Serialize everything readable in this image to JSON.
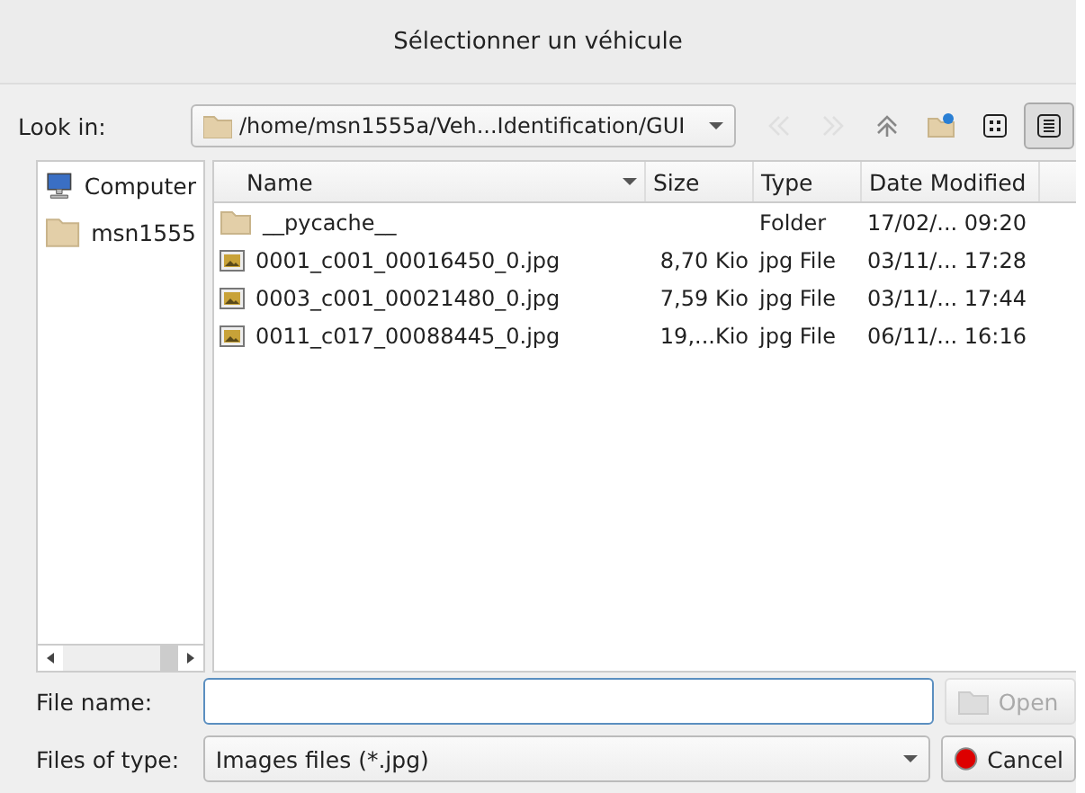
{
  "window": {
    "title": "Sélectionner un véhicule"
  },
  "look_in": {
    "label": "Look in:",
    "path": "/home/msn1555a/Veh...Identification/GUI"
  },
  "toolbar": [
    {
      "kind": "back",
      "disabled": true
    },
    {
      "kind": "forward",
      "disabled": true
    },
    {
      "kind": "up",
      "disabled": false
    },
    {
      "kind": "new-folder",
      "disabled": false
    },
    {
      "kind": "list-view",
      "selected": false
    },
    {
      "kind": "detail-view",
      "selected": true
    }
  ],
  "sidebar": {
    "items": [
      {
        "kind": "computer",
        "label": "Computer"
      },
      {
        "kind": "folder",
        "label": "msn1555"
      }
    ]
  },
  "table": {
    "columns": [
      "Name",
      "Size",
      "Type",
      "Date Modified"
    ],
    "rows": [
      {
        "kind": "folder",
        "name": "__pycache__",
        "size": "",
        "type": "Folder",
        "date": "17/02/... 09:20"
      },
      {
        "kind": "image",
        "name": "0001_c001_00016450_0.jpg",
        "size": "8,70 Kio",
        "type": "jpg File",
        "date": "03/11/... 17:28"
      },
      {
        "kind": "image",
        "name": "0003_c001_00021480_0.jpg",
        "size": "7,59 Kio",
        "type": "jpg File",
        "date": "03/11/... 17:44"
      },
      {
        "kind": "image",
        "name": "0011_c017_00088445_0.jpg",
        "size": "19,...Kio",
        "type": "jpg File",
        "date": "06/11/... 16:16"
      }
    ]
  },
  "file_name": {
    "label": "File name:"
  },
  "file_type": {
    "label": "Files of type:",
    "value": "Images files (*.jpg)"
  },
  "buttons": [
    {
      "kind": "open",
      "label": "Open",
      "disabled": true
    },
    {
      "kind": "cancel",
      "label": "Cancel",
      "disabled": false
    }
  ]
}
